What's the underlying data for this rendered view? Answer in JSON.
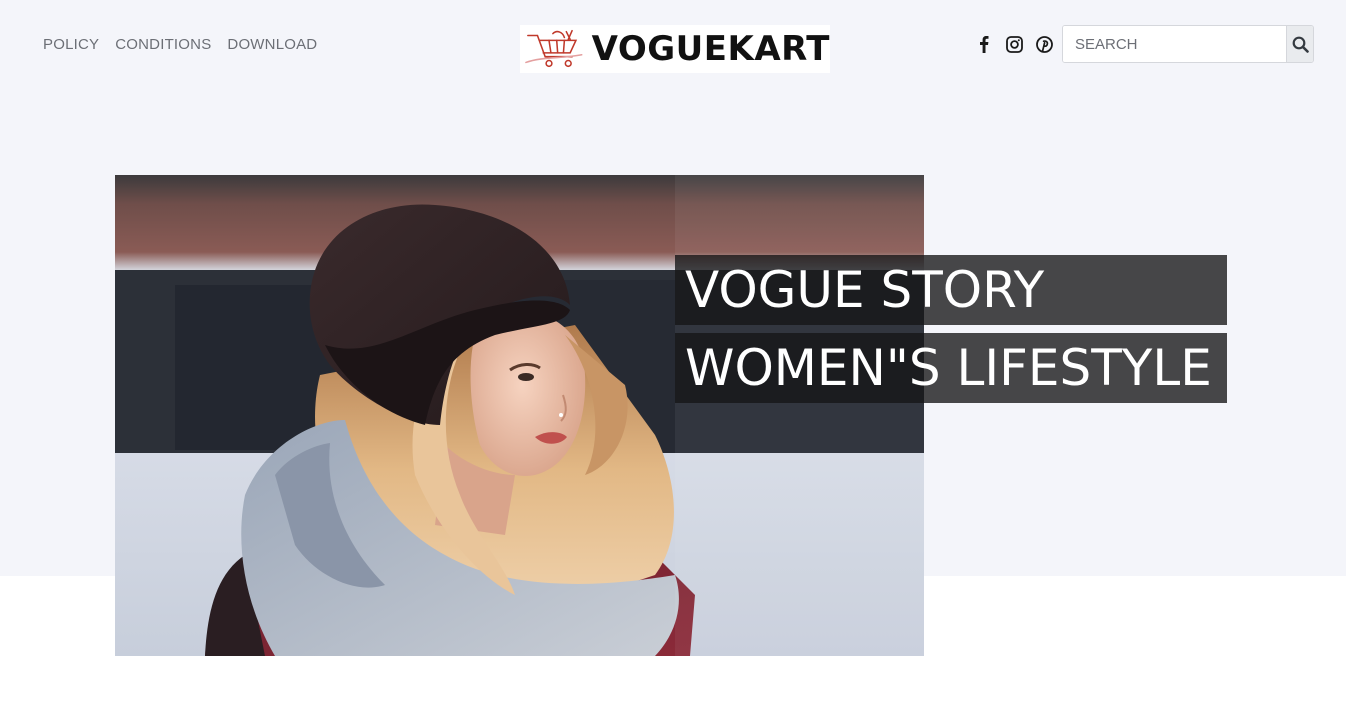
{
  "nav": {
    "items": [
      {
        "label": "POLICY"
      },
      {
        "label": "CONDITIONS"
      },
      {
        "label": "DOWNLOAD"
      }
    ]
  },
  "logo": {
    "text": "VOGUEKART",
    "icon": "shopping-cart-icon"
  },
  "social": {
    "icons": [
      "facebook-icon",
      "instagram-icon",
      "pinterest-icon"
    ]
  },
  "search": {
    "placeholder": "SEARCH",
    "icon": "search-icon"
  },
  "hero": {
    "title_line1": "VOGUE STORY",
    "title_line2": "WOMEN\"S LIFESTYLE",
    "image": "woman-in-beanie-photo"
  },
  "colors": {
    "hero_background": "#f4f5fa",
    "title_overlay": "#141416",
    "nav_text": "#6c6f76"
  }
}
